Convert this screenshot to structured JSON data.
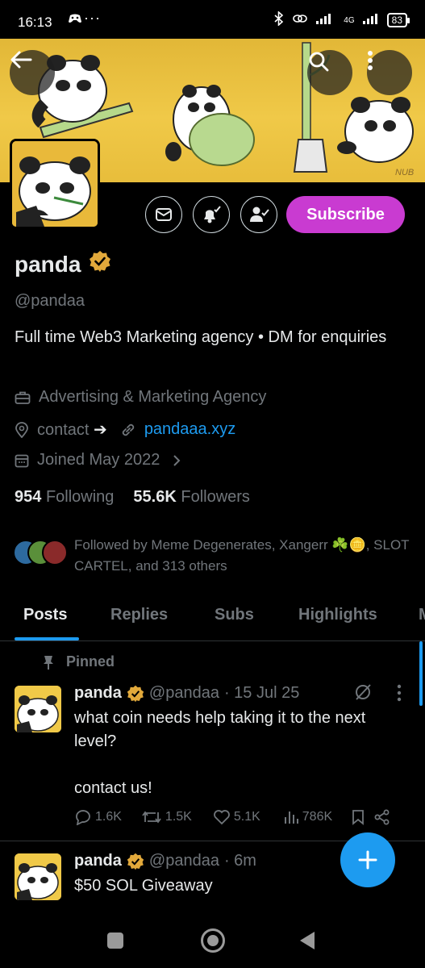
{
  "status": {
    "time": "16:13",
    "battery": "83",
    "network": "4G"
  },
  "profile": {
    "name": "panda",
    "handle": "@pandaa",
    "bio": "Full time Web3 Marketing agency • DM for enquiries",
    "category": "Advertising & Marketing Agency",
    "contact_label": "contact",
    "contact_arrow": "➔",
    "website": "pandaaa.xyz",
    "joined": "Joined May 2022",
    "following_count": "954",
    "following_label": "Following",
    "followers_count": "55.6K",
    "followers_label": "Followers",
    "followed_by": "Followed by Meme Degenerates, Xangerr ☘️🪙, SLOT CARTEL, and 313 others",
    "subscribe_label": "Subscribe",
    "verified_color": "#e2a93b",
    "banner_signature": "NUB"
  },
  "tabs": [
    "Posts",
    "Replies",
    "Subs",
    "Highlights",
    "M"
  ],
  "pinned_label": "Pinned",
  "posts": [
    {
      "name": "panda",
      "handle": "@pandaa",
      "time": "· 15 Jul 25",
      "text1": "what coin needs help taking it to the next level?",
      "text2": "contact us!",
      "replies": "1.6K",
      "reposts": "1.5K",
      "likes": "5.1K",
      "views": "786K"
    },
    {
      "name": "panda",
      "handle": "@pandaa",
      "time": "· 6m",
      "text1": "$50 SOL Giveaway"
    }
  ],
  "colors": {
    "accent": "#1d9bf0",
    "subscribe": "#c93bd1",
    "banner": "#f0c948"
  }
}
